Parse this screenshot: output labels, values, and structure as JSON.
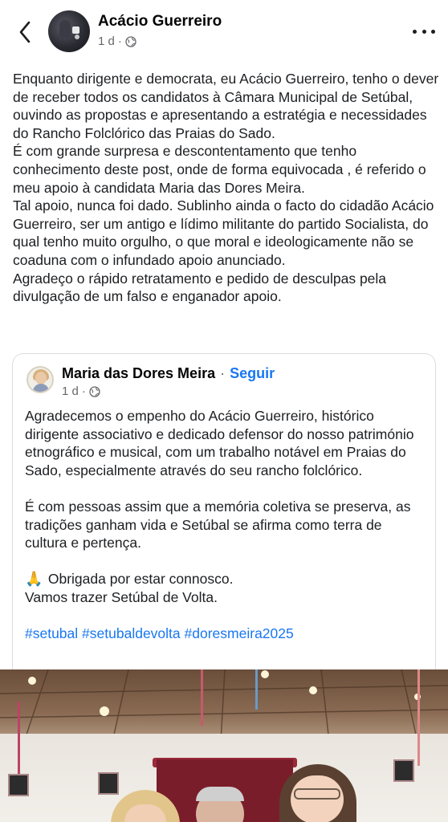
{
  "header": {
    "author": "Acácio Guerreiro",
    "time": "1 d",
    "privacy_icon": "globe-icon",
    "back_icon": "chevron-left-icon",
    "more_icon": "more-horizontal-icon"
  },
  "post": {
    "text": "Enquanto dirigente e democrata, eu Acácio Guerreiro, tenho o dever de receber todos os candidatos à Câmara Municipal de Setúbal, ouvindo as propostas e apresentando a estratégia e necessidades do Rancho Folclórico das Praias do Sado.\nÉ com grande surpresa e descontentamento que tenho conhecimento deste post, onde de forma equivocada , é referido o meu apoio à candidata Maria das Dores Meira.\nTal apoio, nunca foi dado. Sublinho ainda o facto do cidadão Acácio Guerreiro, ser um antigo e lídimo militante do partido Socialista, do qual tenho muito orgulho, o que moral e ideologicamente não se coaduna com o infundado apoio anunciado.\nAgradeço o rápido retratamento e pedido de desculpas pela divulgação de um falso e enganador apoio."
  },
  "shared": {
    "author": "Maria das Dores Meira",
    "separator": "·",
    "follow_label": "Seguir",
    "time": "1 d",
    "paragraph1": "Agradecemos o empenho do Acácio Guerreiro, histórico dirigente associativo e dedicado defensor do nosso património etnográfico e musical, com um trabalho notável em Praias do Sado, especialmente através do seu rancho folclórico.",
    "paragraph2": "É com pessoas assim que a memória coletiva se preserva, as tradições ganham vida e Setúbal se afirma como terra de cultura e pertença.",
    "emoji": "🙏",
    "line3": "Obrigada por estar connosco.",
    "line4": "Vamos trazer Setúbal de Volta.",
    "hashtags": [
      "#setubal",
      "#setubaldevolta",
      "#doresmeira2025"
    ]
  },
  "colors": {
    "link": "#1877f2",
    "text": "#1c1e21",
    "meta": "#65676b",
    "border": "#dadde1"
  }
}
